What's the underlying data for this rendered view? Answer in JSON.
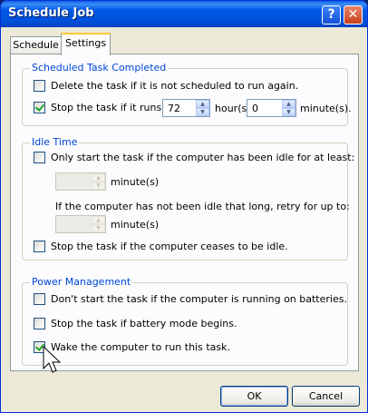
{
  "window": {
    "title": "Schedule Job"
  },
  "titlebar_buttons": {
    "help": "?",
    "close": "✕"
  },
  "tabs": [
    {
      "label": "Schedule"
    },
    {
      "label": "Settings"
    }
  ],
  "scheduled_task_completed": {
    "legend": "Scheduled Task Completed",
    "delete_task": {
      "label": "Delete the task if it is not scheduled to run again.",
      "checked": false
    },
    "stop_task": {
      "label": "Stop the task if it runs for:",
      "checked": true
    },
    "hours": {
      "value": "72",
      "unit": "hour(s)"
    },
    "minutes": {
      "value": "0",
      "unit": "minute(s)."
    }
  },
  "idle_time": {
    "legend": "Idle Time",
    "only_start_idle": {
      "label": "Only start the task if the computer has been idle for at least:",
      "checked": false
    },
    "idle_minutes": {
      "value": "",
      "unit": "minute(s)"
    },
    "retry_text": "If the computer has not been idle that long, retry for up to:",
    "retry_minutes": {
      "value": "",
      "unit": "minute(s)"
    },
    "stop_if_not_idle": {
      "label": "Stop the task if the computer ceases to be idle.",
      "checked": false
    }
  },
  "power_management": {
    "legend": "Power Management",
    "dont_start_batteries": {
      "label": "Don't start the task if the computer is running on batteries.",
      "checked": false
    },
    "stop_battery_mode": {
      "label": "Stop the task if battery mode begins.",
      "checked": false
    },
    "wake_computer": {
      "label": "Wake the computer to run this task.",
      "checked": true
    }
  },
  "buttons": {
    "ok": "OK",
    "cancel": "Cancel"
  }
}
